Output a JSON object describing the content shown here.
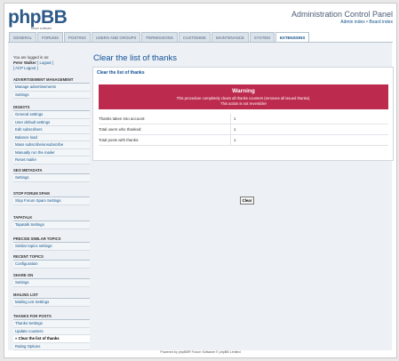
{
  "header": {
    "logo_text": "phpBB",
    "logo_tagline": "forum  software",
    "acp_title": "Administration Control Panel",
    "link_admin_index": "Admin index",
    "link_sep": "•",
    "link_board_index": "Board index"
  },
  "tabs": [
    {
      "label": "GENERAL"
    },
    {
      "label": "FORUMS"
    },
    {
      "label": "POSTING"
    },
    {
      "label": "USERS AND GROUPS"
    },
    {
      "label": "PERMISSIONS"
    },
    {
      "label": "CUSTOMISE"
    },
    {
      "label": "MAINTENANCE"
    },
    {
      "label": "SYSTEM"
    },
    {
      "label": "EXTENSIONS",
      "active": true
    }
  ],
  "sidebar": {
    "logged_in_as": "You are logged in as:",
    "username": "Peter Walker",
    "logout": "[ Logout ]",
    "acp_logout": "[ ACP Logout ]",
    "sections": [
      {
        "heading": "ADVERTISEMENT MANAGEMENT",
        "items": [
          "Manage advertisements",
          "Settings"
        ]
      },
      {
        "heading": "DIGESTS",
        "items": [
          "General settings",
          "User default settings",
          "Edit subscribers",
          "Balance load",
          "Mass subscribe/unsubscribe",
          "Manually run the mailer",
          "Reset mailer"
        ]
      },
      {
        "heading": "SEO METADATA",
        "items": [
          "Settings"
        ]
      },
      {
        "heading": "STOP FORUM SPAM",
        "items": [
          "Stop Forum Spam Settings"
        ]
      },
      {
        "heading": "TAPATALK",
        "items": [
          "Tapatalk Settings"
        ]
      },
      {
        "heading": "PRECISE SIMILAR TOPICS",
        "items": [
          "Similar topics settings"
        ]
      },
      {
        "heading": "RECENT TOPICS",
        "items": [
          "Configuration"
        ]
      },
      {
        "heading": "SHARE ON",
        "items": [
          "Settings"
        ]
      },
      {
        "heading": "MAILING LIST",
        "items": [
          "Mailing List Settings"
        ]
      },
      {
        "heading": "THANKS FOR POSTS",
        "items": [
          "Thanks Settings",
          "Update counters",
          "» Clear the list of thanks",
          "Rating Options"
        ]
      }
    ]
  },
  "main": {
    "title": "Clear the list of thanks",
    "panel_title": "Clear the list of thanks",
    "warning_title": "Warning",
    "warning_line1": "This procedure completely clears all thanks counters (removes all issued thanks).",
    "warning_line2": "This action is not reversible!",
    "stats": [
      {
        "label": "Thanks taken into account:",
        "value": "1"
      },
      {
        "label": "Total users who thanked:",
        "value": "1"
      },
      {
        "label": "Total posts with thanks:",
        "value": "1"
      }
    ],
    "clear_button": "Clear"
  },
  "footer": {
    "text": "Powered by phpBB® Forum Software © phpBB Limited"
  },
  "colors": {
    "warning_bg": "#bc2a4d",
    "link": "#105289",
    "title": "#115098"
  }
}
